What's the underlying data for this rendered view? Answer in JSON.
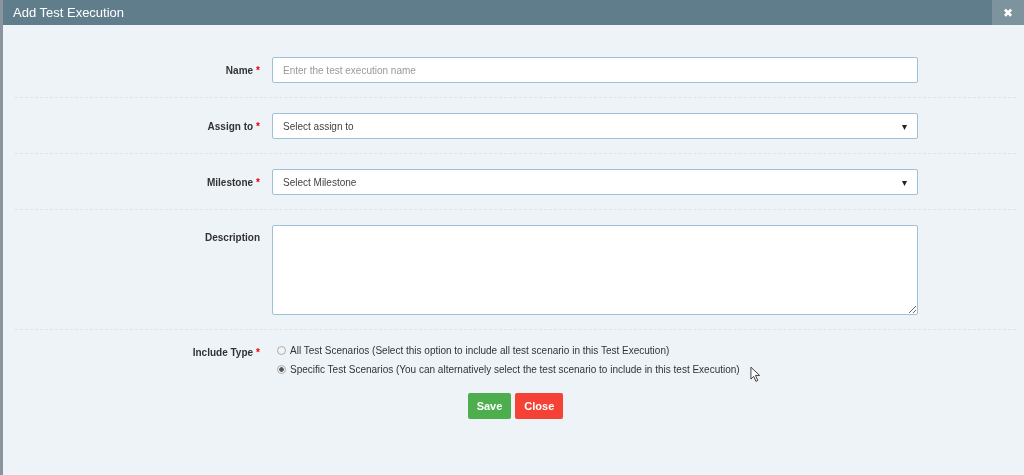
{
  "dialog": {
    "title": "Add Test Execution",
    "close_glyph": "✖"
  },
  "fields": [
    {
      "kind": "text",
      "label": "Name",
      "required_mark": "*",
      "placeholder": "Enter the test execution name"
    },
    {
      "kind": "select",
      "label": "Assign to",
      "required_mark": "*",
      "value": "Select assign to",
      "caret": "▾"
    },
    {
      "kind": "select",
      "label": "Milestone",
      "required_mark": "*",
      "value": "Select Milestone",
      "caret": "▾"
    },
    {
      "kind": "textarea",
      "label": "Description"
    }
  ],
  "include_type": {
    "label": "Include Type",
    "required_mark": "*",
    "options": [
      {
        "label": "All Test Scenarios (Select this option to include all test scenario in this Test Execution)",
        "selected": false
      },
      {
        "label": "Specific Test Scenarios (You can alternatively select the test scenario to include in this test Execution)",
        "selected": true
      }
    ]
  },
  "buttons": [
    {
      "kind": "save",
      "label": "Save"
    },
    {
      "kind": "close",
      "label": "Close"
    }
  ]
}
